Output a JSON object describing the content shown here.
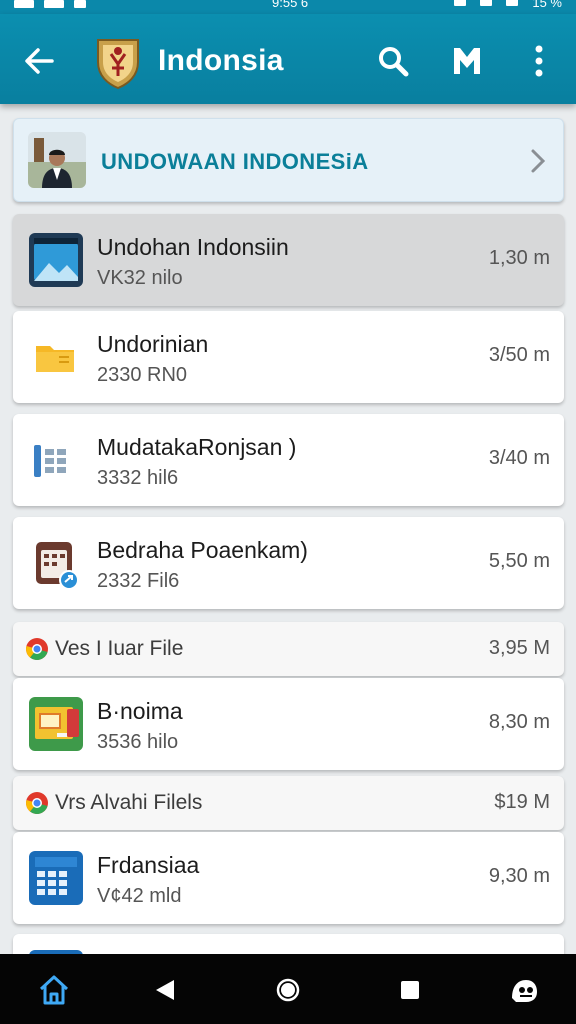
{
  "status_bar": {
    "time": "9:55 6",
    "battery": "15 %"
  },
  "app_bar": {
    "title": "Indonsia",
    "icons": [
      "back-arrow-icon",
      "coat-of-arms-icon",
      "search-icon",
      "m-logo-icon",
      "more-vert-icon"
    ]
  },
  "header_card": {
    "title": "UNDOWAAN INDONESiA"
  },
  "items": [
    {
      "name": "Undohan Indonsiin",
      "sub": "VK32 nilo",
      "time": "1,30 m",
      "icon": "image-file-icon",
      "selected": true
    },
    {
      "name": "Undorinian",
      "sub": "2330 RN0",
      "time": "3/50 m",
      "icon": "folder-icon"
    },
    {
      "name": "MudatakaRonjsan )",
      "sub": "3332 hil6",
      "time": "3/40 m",
      "icon": "grid-app-icon"
    },
    {
      "name": "Bedraha Poaenkam)",
      "sub": "2332 Fil6",
      "time": "5,50 m",
      "icon": "calendar-share-icon"
    }
  ],
  "section1": {
    "title": "Ves I Iuar File",
    "size": "3,95 M",
    "icon": "chrome-icon"
  },
  "items2": [
    {
      "name": "B·noima",
      "sub": "3536 hilo",
      "time": "8,30 m",
      "icon": "slides-app-icon"
    }
  ],
  "section2": {
    "title": "Vrs Alvahi Filels",
    "size": "$19 M",
    "icon": "chrome-icon"
  },
  "items3": [
    {
      "name": "Frdansiaa",
      "sub": "V¢42 mld",
      "time": "9,30 m",
      "icon": "calculator-app-icon"
    }
  ],
  "nav": [
    "home-icon",
    "back-triangle-icon",
    "home-circle-icon",
    "recents-square-icon",
    "assistant-icon"
  ],
  "colors": {
    "app_bar": "#0b8fb0",
    "accent_text": "#0b7f99"
  }
}
